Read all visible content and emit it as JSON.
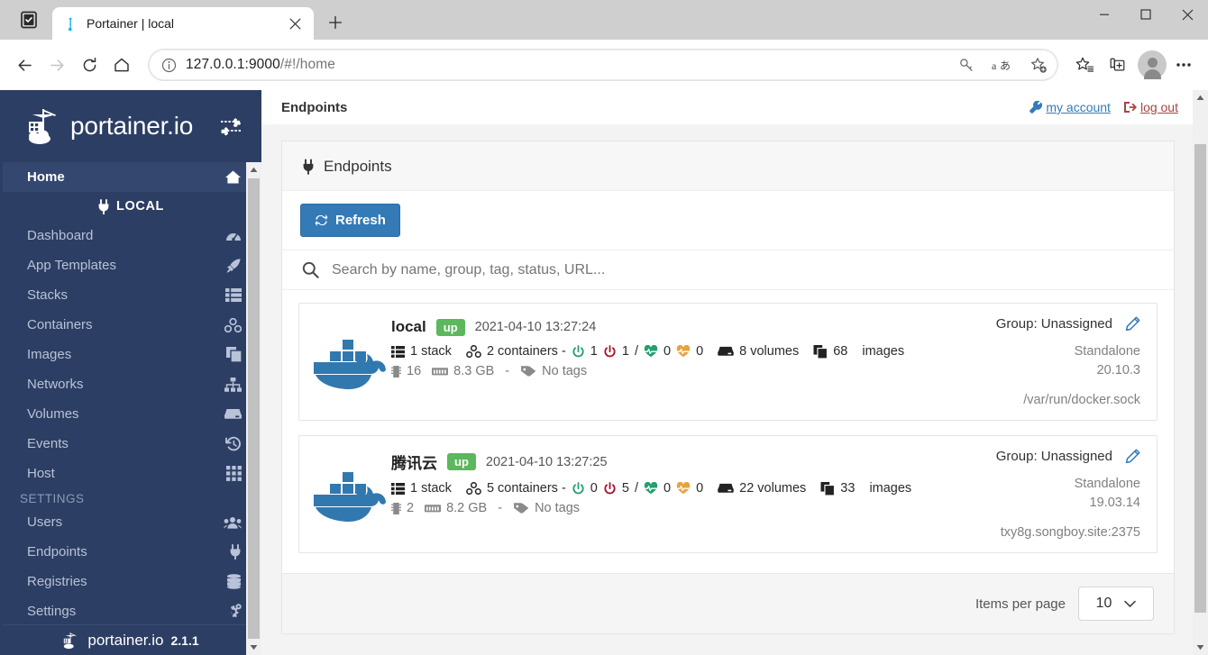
{
  "browser": {
    "collections_icon": "collections-icon",
    "tab": {
      "title": "Portainer | local",
      "favicon": "portainer-favicon",
      "close_icon": "close-icon"
    },
    "newtab_icon": "new-tab-icon",
    "window": {
      "minimize": "minimize-icon",
      "maximize": "maximize-icon",
      "close": "window-close-icon"
    },
    "nav": {
      "back": "back-arrow-icon",
      "forward": "forward-arrow-icon",
      "reload": "reload-icon",
      "home": "home-icon"
    },
    "omnibox": {
      "info_icon": "site-info-icon",
      "url_host": "127.0.0.1:9000",
      "url_path": "/#!/home",
      "key_icon": "password-key-icon",
      "translate_icon": "translate-icon",
      "favorite_icon": "add-favorite-icon"
    },
    "actions": {
      "favorites_icon": "favorites-icon",
      "collections_icon": "add-collection-icon",
      "profile_icon": "profile-avatar-icon",
      "settings_icon": "more-options-icon"
    }
  },
  "sidebar": {
    "brand": "portainer.io",
    "brand_logo": "portainer-crane-logo",
    "toggle_icon": "collapse-sidebar-icon",
    "home": {
      "label": "Home",
      "icon": "home-icon"
    },
    "section": {
      "label": "LOCAL",
      "icon": "plug-icon"
    },
    "items": [
      {
        "label": "Dashboard",
        "icon": "dashboard-tachometer-icon"
      },
      {
        "label": "App Templates",
        "icon": "rocket-icon"
      },
      {
        "label": "Stacks",
        "icon": "stacks-list-icon"
      },
      {
        "label": "Containers",
        "icon": "containers-icon"
      },
      {
        "label": "Images",
        "icon": "images-clone-icon"
      },
      {
        "label": "Networks",
        "icon": "networks-sitemap-icon"
      },
      {
        "label": "Volumes",
        "icon": "volumes-hdd-icon"
      },
      {
        "label": "Events",
        "icon": "events-history-icon"
      },
      {
        "label": "Host",
        "icon": "host-grid-icon"
      }
    ],
    "settings_label": "SETTINGS",
    "settings_items": [
      {
        "label": "Users",
        "icon": "users-icon"
      },
      {
        "label": "Endpoints",
        "icon": "plug-icon"
      },
      {
        "label": "Registries",
        "icon": "registries-database-icon"
      },
      {
        "label": "Settings",
        "icon": "settings-gears-icon"
      }
    ],
    "footer": {
      "brand": "portainer.io",
      "version": "2.1.1",
      "logo": "portainer-crane-logo"
    }
  },
  "topbar": {
    "title": "Endpoints",
    "my_account": {
      "label": "my account",
      "icon": "wrench-icon"
    },
    "log_out": {
      "label": "log out",
      "icon": "sign-out-icon"
    }
  },
  "panel": {
    "heading": {
      "label": "Endpoints",
      "icon": "plug-icon"
    },
    "refresh_button": {
      "label": "Refresh",
      "icon": "refresh-sync-icon"
    },
    "search": {
      "placeholder": "Search by name, group, tag, status, URL...",
      "value": "",
      "icon": "search-icon"
    },
    "footer": {
      "items_per_page_label": "Items per page",
      "items_per_page_value": "10",
      "chevron_icon": "chevron-down-icon"
    }
  },
  "endpoints": [
    {
      "logo": "docker-whale-icon",
      "name": "local",
      "status": "up",
      "timestamp": "2021-04-10 13:27:24",
      "stacks": "1 stack",
      "stacks_icon": "stack-list-icon",
      "containers": "2 containers -",
      "containers_icon": "containers-icon",
      "running": "1",
      "running_icon": "power-on-icon",
      "stopped": "1",
      "stopped_icon": "power-off-icon",
      "separator": "/",
      "healthy": "0",
      "healthy_icon": "heartbeat-green-icon",
      "unhealthy": "0",
      "unhealthy_icon": "heartbeat-orange-icon",
      "volumes": "8 volumes",
      "volumes_icon": "volumes-hdd-icon",
      "images": "68",
      "images_icon": "images-clone-icon",
      "images_wrap_label": "images",
      "cpu": "16",
      "cpu_icon": "cpu-microchip-icon",
      "memory": "8.3 GB",
      "memory_icon": "memory-ram-icon",
      "dash": "-",
      "tags": "No tags",
      "tags_icon": "tags-icon",
      "group": "Group: Unassigned",
      "edit_icon": "edit-pencil-icon",
      "mode": "Standalone",
      "version": "20.10.3",
      "url": "/var/run/docker.sock"
    },
    {
      "logo": "docker-whale-icon",
      "name": "腾讯云",
      "status": "up",
      "timestamp": "2021-04-10 13:27:25",
      "stacks": "1 stack",
      "stacks_icon": "stack-list-icon",
      "containers": "5 containers -",
      "containers_icon": "containers-icon",
      "running": "0",
      "running_icon": "power-on-icon",
      "stopped": "5",
      "stopped_icon": "power-off-icon",
      "separator": "/",
      "healthy": "0",
      "healthy_icon": "heartbeat-green-icon",
      "unhealthy": "0",
      "unhealthy_icon": "heartbeat-orange-icon",
      "volumes": "22 volumes",
      "volumes_icon": "volumes-hdd-icon",
      "images": "33",
      "images_icon": "images-clone-icon",
      "images_wrap_label": "images",
      "cpu": "2",
      "cpu_icon": "cpu-microchip-icon",
      "memory": "8.2 GB",
      "memory_icon": "memory-ram-icon",
      "dash": "-",
      "tags": "No tags",
      "tags_icon": "tags-icon",
      "group": "Group: Unassigned",
      "edit_icon": "edit-pencil-icon",
      "mode": "Standalone",
      "version": "19.03.14",
      "url": "txy8g.songboy.site:2375"
    }
  ],
  "colors": {
    "sidebar_bg": "#2c3e63",
    "sidebar_active": "#34486f",
    "primary_blue": "#337ab7",
    "status_up_green": "#5cb85c",
    "running_green": "#23a06e",
    "stopped_red": "#a8122a",
    "healthy_green": "#23a06e",
    "unhealthy_orange": "#e8a33d",
    "docker_blue": "#3178ae",
    "logout_red": "#a94442"
  }
}
